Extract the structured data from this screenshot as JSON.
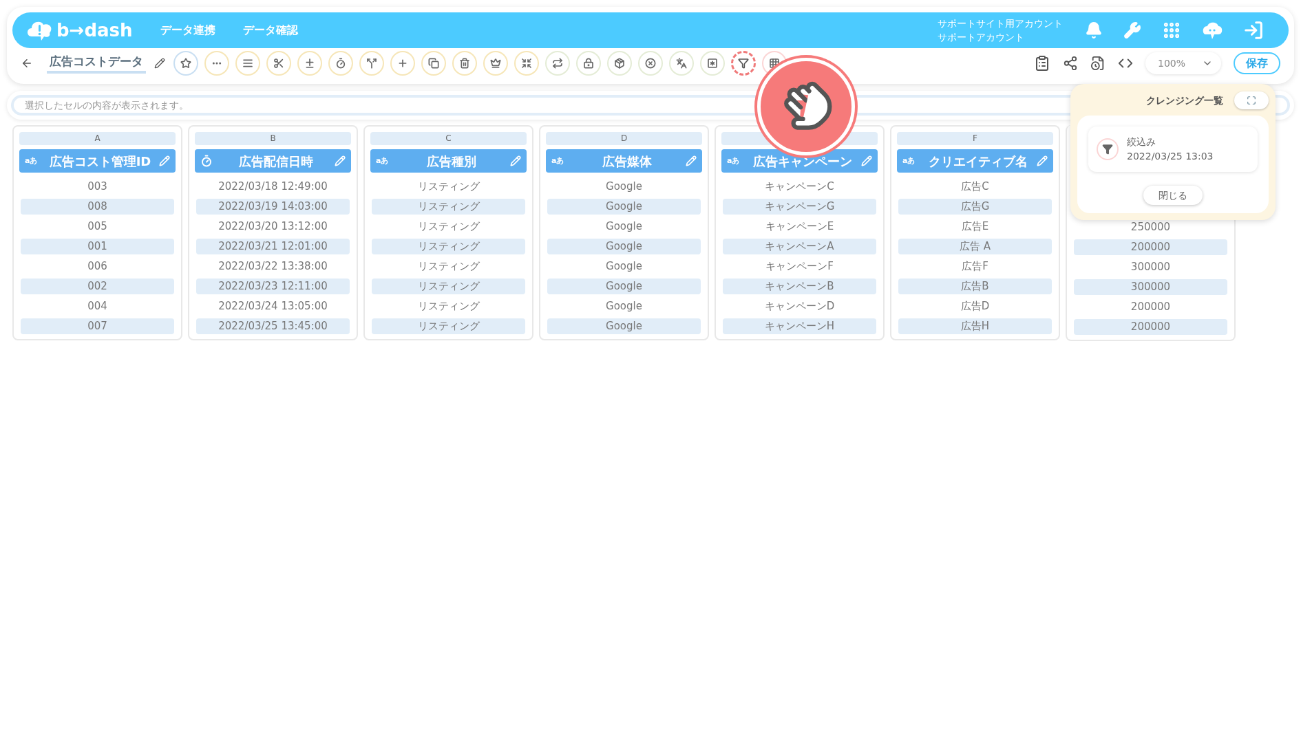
{
  "header": {
    "logo_text": "b→dash",
    "nav": [
      "データ連携",
      "データ確認"
    ],
    "account": [
      "サポートサイト用アカウント",
      "サポートアカウント"
    ]
  },
  "toolbar": {
    "title": "広告コストデータ",
    "tools": [
      {
        "highlighted": false
      },
      {
        "highlighted": false
      },
      {
        "highlighted": false
      },
      {
        "highlighted": false
      },
      {
        "highlighted": false
      },
      {
        "highlighted": false
      },
      {
        "highlighted": false
      },
      {
        "highlighted": false
      },
      {
        "highlighted": false
      },
      {
        "highlighted": false
      },
      {
        "highlighted": false
      },
      {
        "highlighted": false
      },
      {
        "highlighted": false
      },
      {
        "highlighted": false
      },
      {
        "highlighted": false
      },
      {
        "highlighted": false
      },
      {
        "highlighted": false
      },
      {
        "highlighted": false
      },
      {
        "highlighted": true
      },
      {
        "highlighted": false
      }
    ],
    "zoom": "100%",
    "save": "保存"
  },
  "cell_preview": {
    "placeholder": "選択したセルの内容が表示されます。"
  },
  "table": {
    "columns": [
      {
        "letter": "A",
        "kind": "text",
        "type_label": "aあ",
        "header": "広告コスト管理ID",
        "cells": [
          "003",
          "008",
          "005",
          "001",
          "006",
          "002",
          "004",
          "007"
        ]
      },
      {
        "letter": "B",
        "kind": "datetime",
        "header": "広告配信日時",
        "cells": [
          "2022/03/18 12:49:00",
          "2022/03/19 14:03:00",
          "2022/03/20 13:12:00",
          "2022/03/21 12:01:00",
          "2022/03/22 13:38:00",
          "2022/03/23 12:11:00",
          "2022/03/24 13:05:00",
          "2022/03/25 13:45:00"
        ]
      },
      {
        "letter": "C",
        "kind": "text",
        "type_label": "aあ",
        "header": "広告種別",
        "cells": [
          "リスティング",
          "リスティング",
          "リスティング",
          "リスティング",
          "リスティング",
          "リスティング",
          "リスティング",
          "リスティング"
        ]
      },
      {
        "letter": "D",
        "kind": "text",
        "type_label": "aあ",
        "header": "広告媒体",
        "cells": [
          "Google",
          "Google",
          "Google",
          "Google",
          "Google",
          "Google",
          "Google",
          "Google"
        ]
      },
      {
        "kind": "text",
        "type_label": "aあ",
        "header": "広告キャンペーン",
        "cells": [
          "キャンペーンC",
          "キャンペーンG",
          "キャンペーンE",
          "キャンペーンA",
          "キャンペーンF",
          "キャンペーンB",
          "キャンペーンD",
          "キャンペーンH"
        ]
      },
      {
        "letter": "F",
        "kind": "text",
        "type_label": "aあ",
        "header": "クリエイティブ名",
        "cells": [
          "広告C",
          "広告G",
          "広告E",
          "広告 A",
          "広告F",
          "広告B",
          "広告D",
          "広告H"
        ]
      },
      {
        "kind": "hidden",
        "cells": [
          "250000",
          "200000",
          "300000",
          "300000",
          "200000",
          "200000"
        ]
      }
    ]
  },
  "cleansing_panel": {
    "title": "クレンジング一覧",
    "items": [
      {
        "name": "絞込み",
        "time": "2022/03/25 13:03"
      }
    ],
    "close": "閉じる"
  }
}
